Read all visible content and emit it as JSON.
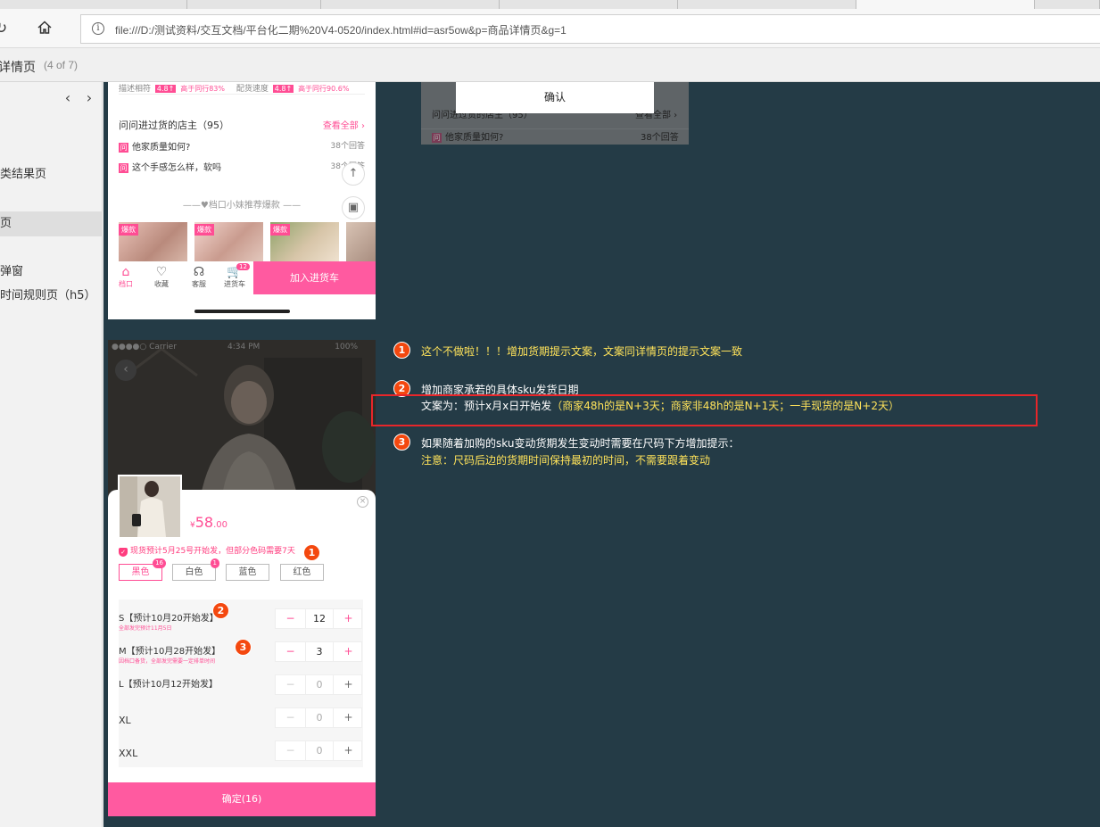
{
  "browser": {
    "url": "file:///D:/测试资料/交互文档/平台化二期%20V4-0520/index.html#id=asr5ow&p=商品详情页&g=1"
  },
  "page": {
    "title": "详情页",
    "count": "(4 of 7)"
  },
  "sidebar": {
    "prev": "‹",
    "next": "›",
    "items": [
      {
        "label": "类结果页"
      },
      {
        "label": "页"
      },
      {
        "label": "弹窗"
      },
      {
        "label": "时间规则页（h5）"
      }
    ]
  },
  "detail_top": {
    "rating": {
      "desc_label": "描述相符",
      "desc_score": "4.8↑",
      "desc_sub": "高于同行83%",
      "ship_label": "配货速度",
      "ship_score": "4.8↑",
      "ship_sub": "高于同行90.6%"
    },
    "qa": {
      "header": "问问进过货的店主（95）",
      "more": "查看全部 ›",
      "badge": "问",
      "items": [
        {
          "q": "他家质量如何?",
          "count": "38个回答"
        },
        {
          "q": "这个手感怎么样，软吗",
          "count": "38个回答"
        }
      ]
    },
    "recommend_title": "——♥档口小妹推荐爆款 ——",
    "hot_tag": "爆款",
    "tabs": [
      {
        "icon": "⌂",
        "label": "档口"
      },
      {
        "icon": "♡",
        "label": "收藏"
      },
      {
        "icon": "☊",
        "label": "客服"
      },
      {
        "icon": "🛒",
        "label": "进货车"
      }
    ],
    "cart_count": "12",
    "add_to_cart": "加入进货车",
    "scroll_top": "↑",
    "image_btn": "▣"
  },
  "dialog_fragment": {
    "confirm": "确认",
    "qa_header": "问问进过货的店主（95）",
    "qa_more": "查看全部 ›",
    "qa_item": "他家质量如何?",
    "qa_count": "38个回答",
    "badge": "问"
  },
  "sku_sheet": {
    "status_left": "●●●●○ Carrier",
    "status_time": "4:34 PM",
    "status_right": "100%",
    "back": "‹",
    "price": {
      "currency": "¥",
      "main": "58",
      "cents": ".00"
    },
    "close": "×",
    "notice": "现货预计5月25号开始发，但部分色码需要7天",
    "shield": "✓",
    "colors": [
      {
        "label": "黑色",
        "badge": "16"
      },
      {
        "label": "白色",
        "badge": "1"
      },
      {
        "label": "蓝色",
        "badge": ""
      },
      {
        "label": "红色",
        "badge": ""
      }
    ],
    "sizes": [
      {
        "name": "S【预计10月20开始发】",
        "sub": "全部发完预计11月5日",
        "qty": "12",
        "minus": "−",
        "plus": "+"
      },
      {
        "name": "M【预计10月28开始发】",
        "sub": "因档口备货，全部发完需要一定排单时间",
        "qty": "3",
        "minus": "−",
        "plus": "+"
      },
      {
        "name": "L【预计10月12开始发】",
        "sub": "",
        "qty": "0",
        "minus": "−",
        "plus": "+"
      },
      {
        "name": "XL",
        "sub": "",
        "qty": "0",
        "minus": "−",
        "plus": "+"
      },
      {
        "name": "XXL",
        "sub": "",
        "qty": "0",
        "minus": "−",
        "plus": "+"
      }
    ],
    "confirm": "确定(16)"
  },
  "markers": [
    "1",
    "2",
    "3"
  ],
  "annotations": {
    "note1": "这个不做啦！！！增加货期提示文案，文案同详情页的提示文案一致",
    "note2_title": "增加商家承若的具体sku发货日期",
    "note2_prefix": "文案为：预计x月x日开始发",
    "note2_detail": "（商家48h的是N+3天；商家非48h的是N+1天；一手现货的是N+2天）",
    "note3_title": "如果随着加购的sku变动货期发生变动时需要在尺码下方增加提示：",
    "note3_detail": "注意：尺码后边的货期时间保持最初的时间，不需要跟着变动"
  },
  "colors": {
    "canvas_bg": "#243b46",
    "accent_pink": "#ff4d94",
    "marker_orange": "#f4480f",
    "note_yellow": "#ffe35a",
    "highlight_red": "#e8262a"
  }
}
